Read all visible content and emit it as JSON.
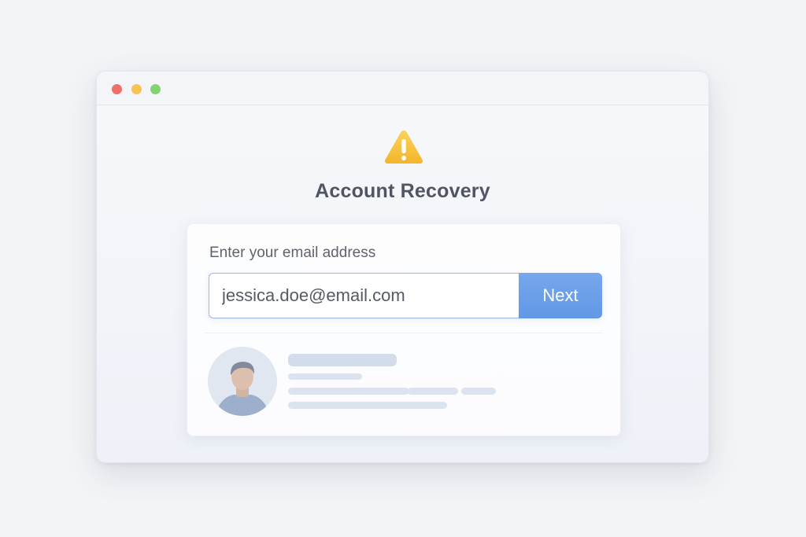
{
  "window": {
    "controls": [
      "close",
      "minimize",
      "maximize"
    ]
  },
  "header": {
    "icon": "warning-triangle-icon",
    "title": "Account Recovery"
  },
  "form": {
    "email_label": "Enter your email address",
    "email_value": "jessica.doe@email.com",
    "next_label": "Next"
  },
  "account_preview": {
    "avatar": "user-avatar"
  },
  "colors": {
    "accent": "#6a9fe9",
    "warning": "#f6bd3a",
    "close_dot": "#ef6f6b",
    "minimize_dot": "#f5c453",
    "maximize_dot": "#83d373"
  }
}
